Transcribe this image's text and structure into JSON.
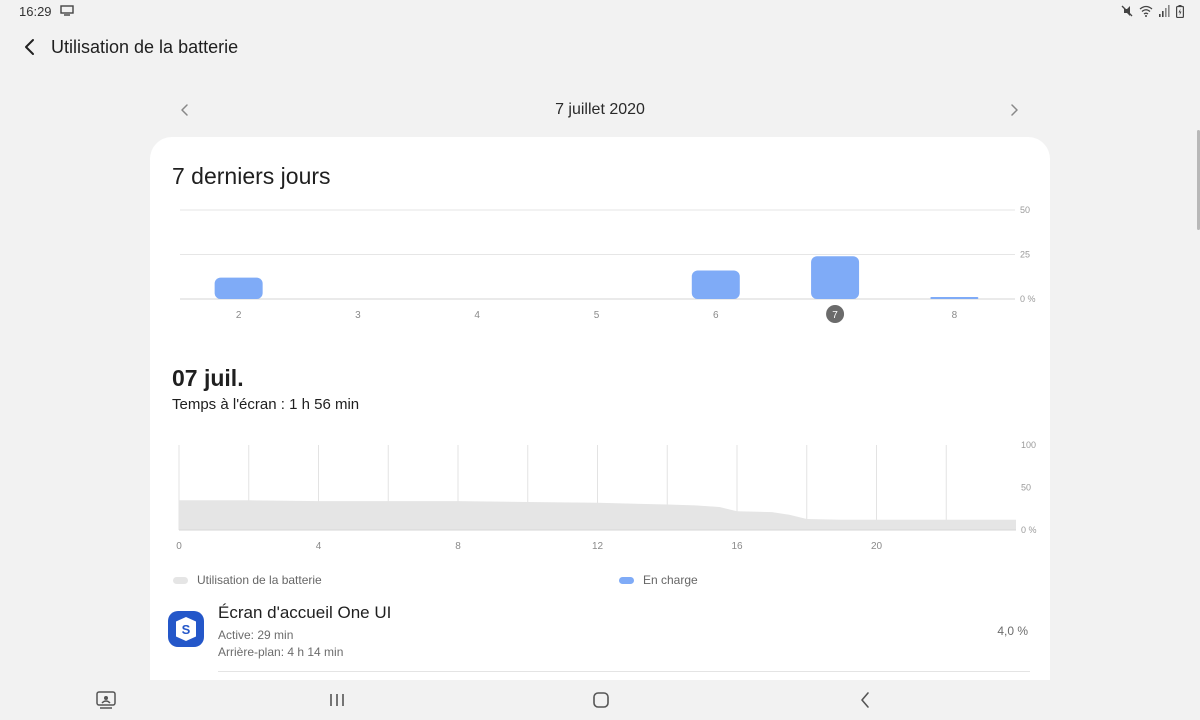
{
  "status_bar": {
    "time": "16:29"
  },
  "header": {
    "title": "Utilisation de la batterie"
  },
  "date_nav": {
    "date": "7 juillet 2020"
  },
  "card": {
    "week_title": "7 derniers jours",
    "day_title": "07 juil.",
    "screen_time": "Temps à l'écran : 1 h 56 min",
    "legend": {
      "usage_label": "Utilisation de la batterie",
      "charge_label": "En charge"
    },
    "apps": [
      {
        "name": "Écran d'accueil One UI",
        "active": "Active: 29 min",
        "background": "Arrière-plan: 4 h 14 min",
        "percent": "4,0 %"
      }
    ]
  },
  "colors": {
    "accent_bar": "#7fabf7",
    "usage_area": "#e5e5e5",
    "selected_day": "#6b6b6b",
    "app_icon": "#2457c9"
  },
  "chart_data": [
    {
      "type": "bar",
      "title": "7 derniers jours",
      "categories": [
        "2",
        "3",
        "4",
        "5",
        "6",
        "7",
        "8"
      ],
      "values": [
        12,
        0,
        0,
        0,
        16,
        24,
        1
      ],
      "selected_category": "7",
      "ylim": [
        0,
        50
      ],
      "yticks": [
        "50",
        "25",
        "0 %"
      ],
      "grid": true
    },
    {
      "type": "area",
      "x": [
        0,
        2,
        4,
        6,
        8,
        10,
        12,
        14,
        14.8,
        15.5,
        16,
        17,
        17.5,
        18,
        19,
        20,
        21,
        22,
        23,
        24
      ],
      "values": [
        35,
        35,
        34,
        34,
        34,
        33,
        32,
        30,
        29,
        27,
        22,
        21,
        18,
        13,
        12,
        12,
        12,
        12,
        12,
        12
      ],
      "xticks": [
        "0",
        "4",
        "8",
        "12",
        "16",
        "20"
      ],
      "xlim": [
        0,
        24
      ],
      "ylim": [
        0,
        100
      ],
      "yticks": [
        "100",
        "50",
        "0 %"
      ],
      "grid": true
    }
  ]
}
